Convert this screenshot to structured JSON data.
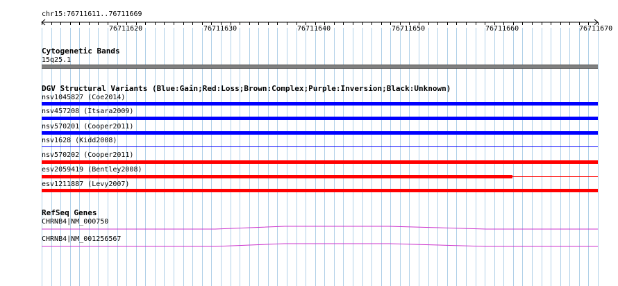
{
  "ruler": {
    "location": "chr15:76711611..76711669",
    "ticks": [
      "76711620",
      "76711630",
      "76711640",
      "76711650",
      "76711660",
      "76711670"
    ]
  },
  "tracks": {
    "cytoband": {
      "title": "Cytogenetic Bands",
      "band": "15q25.1",
      "color": "#808080"
    },
    "dgv": {
      "title": "DGV Structural Variants (Blue:Gain;Red:Loss;Brown:Complex;Purple:Inversion;Black:Unknown)",
      "variants": [
        {
          "label": "nsv1045827 (Coe2014)",
          "type": "Gain",
          "color": "#0000ff"
        },
        {
          "label": "nsv457208 (Itsara2009)",
          "type": "Gain",
          "color": "#0000ff"
        },
        {
          "label": "nsv570201 (Cooper2011)",
          "type": "Gain",
          "color": "#0000ff"
        },
        {
          "label": "nsv1628 (Kidd2008)",
          "type": "Gain",
          "color": "#0000ff"
        },
        {
          "label": "nsv570202 (Cooper2011)",
          "type": "Loss",
          "color": "#ff0000"
        },
        {
          "label": "esv2059419 (Bentley2008)",
          "type": "Loss",
          "color": "#ff0000"
        },
        {
          "label": "esv1211887 (Levy2007)",
          "type": "Loss",
          "color": "#ff0000"
        }
      ]
    },
    "refseq": {
      "title": "RefSeq Genes",
      "genes": [
        {
          "label": "CHRNB4|NM_000750",
          "color": "#cc33cc"
        },
        {
          "label": "CHRNB4|NM_001256567",
          "color": "#cc33cc"
        }
      ]
    }
  },
  "colors": {
    "grid": "#b0d0e8",
    "background": "#ffffff"
  }
}
